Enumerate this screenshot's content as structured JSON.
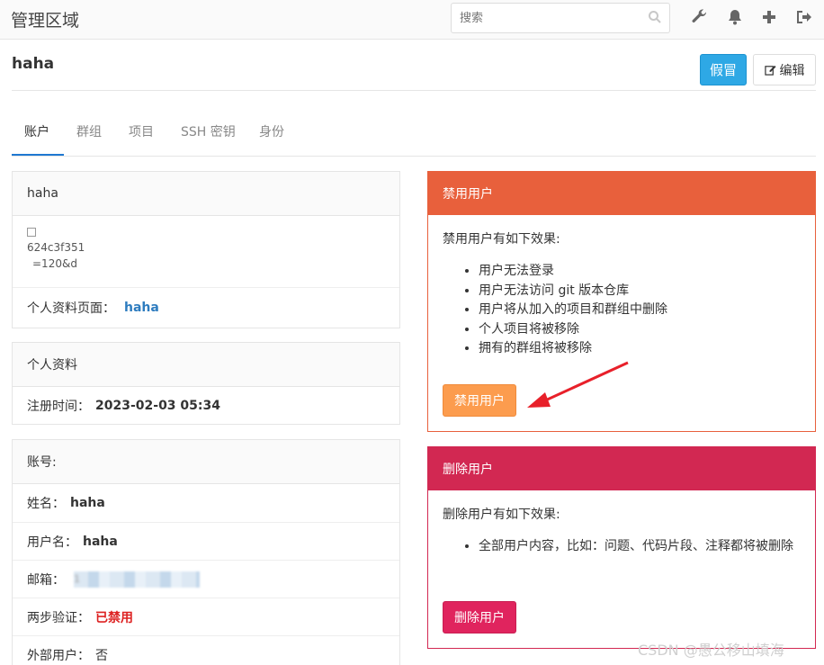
{
  "topbar": {
    "brand": "管理区域",
    "search_placeholder": "搜索",
    "icons": [
      "search-icon",
      "wrench-icon",
      "bell-icon",
      "plus-icon",
      "sign-out-icon"
    ]
  },
  "header": {
    "username": "haha",
    "impersonate_label": "假冒",
    "edit_label": "编辑"
  },
  "tabs": [
    "账户",
    "群组",
    "项目",
    "SSH 密钥",
    "身份"
  ],
  "profile_card": {
    "title": "haha",
    "avatar_alt_line1": "624c3f351",
    "avatar_alt_line2": "=120&d",
    "profile_page_label": "个人资料页面：",
    "profile_page_value": "haha"
  },
  "personal_card": {
    "title": "个人资料",
    "registered_label": "注册时间：",
    "registered_value": "2023-02-03 05:34"
  },
  "account_card": {
    "title": "账号:",
    "rows": [
      {
        "label": "姓名：",
        "value": "haha"
      },
      {
        "label": "用户名：",
        "value": "haha"
      },
      {
        "label": "邮箱：",
        "value": "1"
      },
      {
        "label": "两步验证：",
        "value": "已禁用"
      },
      {
        "label": "外部用户：",
        "value": "否"
      }
    ]
  },
  "block_panel": {
    "title": "禁用用户",
    "intro": "禁用用户有如下效果:",
    "items": [
      "用户无法登录",
      "用户无法访问 git 版本仓库",
      "用户将从加入的项目和群组中删除",
      "个人项目将被移除",
      "拥有的群组将被移除"
    ],
    "button": "禁用用户"
  },
  "delete_panel": {
    "title": "删除用户",
    "intro": "删除用户有如下效果:",
    "items": [
      "全部用户内容，比如：问题、代码片段、注释都将被删除"
    ],
    "button": "删除用户"
  },
  "watermark": "CSDN @愚公移山填海",
  "colors": {
    "primary": "#2ea8e5",
    "warning": "#e8603c",
    "danger": "#d22852",
    "annotation_arrow": "#e8202a"
  }
}
